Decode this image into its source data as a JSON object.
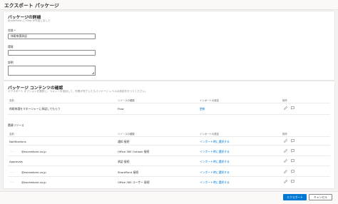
{
  "page": {
    "title": "エクスポート パッケージ"
  },
  "details": {
    "heading": "パッケージの詳細",
    "subheading": "SharePoint に Flow が作成しました",
    "name_label": "名前",
    "name_required": "*",
    "name_value": "休暇申請承認",
    "env_label": "環境",
    "env_value": "",
    "desc_label": "説明"
  },
  "contents": {
    "heading": "パッケージ コンテンツの確認",
    "subheading": "エクスポート オプションを選択し、コメントを追加して、作業が完了したらパッケージ レベルの設定を行ってください。",
    "columns": {
      "name": "名前",
      "type": "リソースの種類",
      "import": "インポートの設定",
      "actions": "操作"
    },
    "main_row": {
      "name": "休暇申請をマネージャーに承認してもらう",
      "type": "Flow",
      "import": "更新"
    },
    "related_label": "関連リソース",
    "related": [
      {
        "name": "Notifications",
        "type": "通知 接続",
        "import": "インポート時に選択する",
        "indent": 0
      },
      {
        "name": "@exceedone.co.jp",
        "type": "Office 365 Outlook 接続",
        "import": "インポート時に選択する",
        "indent": 1
      },
      {
        "name": "Approvals",
        "type": "承認 接続",
        "import": "インポート時に選択する",
        "indent": 0
      },
      {
        "name": "@exceedone.co.jp",
        "type": "SharePoint 接続",
        "import": "インポート時に選択する",
        "indent": 1
      },
      {
        "name": "@exceedone.co.jp",
        "type": "Office 365 ユーザー 接続",
        "import": "インポート時に選択する",
        "indent": 1
      }
    ],
    "dash": "– –"
  },
  "footer": {
    "export_label": "エクスポート",
    "cancel_label": "キャンセル"
  },
  "colors": {
    "accent": "#0078d4",
    "link": "#0078d4",
    "background": "#f3f2f1"
  }
}
